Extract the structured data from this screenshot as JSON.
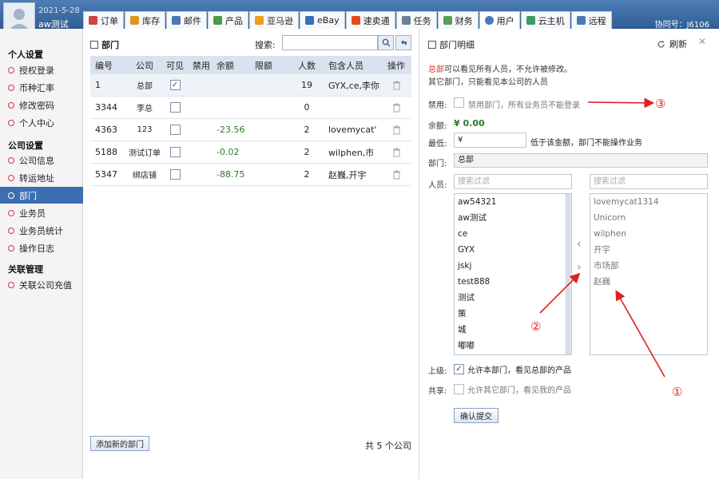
{
  "header": {
    "date": "2021-5-28",
    "user": "aw测试",
    "association_label": "协同号：",
    "association_id": "J6106",
    "tabs": [
      {
        "label": "订单",
        "icon": "order-icon",
        "color": "#c44"
      },
      {
        "label": "库存",
        "icon": "inventory-icon",
        "color": "#e39420"
      },
      {
        "label": "邮件",
        "icon": "mail-icon",
        "color": "#4a7bb7"
      },
      {
        "label": "产品",
        "icon": "product-icon",
        "color": "#4c9a4c"
      },
      {
        "label": "亚马逊",
        "icon": "amazon-icon",
        "color": "#f19e1a"
      },
      {
        "label": "eBay",
        "icon": "ebay-icon",
        "color": "#3b6fb6"
      },
      {
        "label": "速卖通",
        "icon": "aliexpress-icon",
        "color": "#e04a1f"
      },
      {
        "label": "任务",
        "icon": "task-icon",
        "color": "#6d7f96"
      },
      {
        "label": "财务",
        "icon": "finance-icon",
        "color": "#52a152"
      },
      {
        "label": "用户",
        "icon": "user-icon",
        "color": "#4a7bb7"
      },
      {
        "label": "云主机",
        "icon": "cloud-host-icon",
        "color": "#3a9a6a"
      },
      {
        "label": "远程",
        "icon": "remote-icon",
        "color": "#4a7bb7"
      }
    ]
  },
  "sidebar": {
    "groups": [
      {
        "heading": "个人设置",
        "items": [
          "授权登录",
          "币种汇率",
          "修改密码",
          "个人中心"
        ]
      },
      {
        "heading": "公司设置",
        "items": [
          "公司信息",
          "转运地址",
          "部门",
          "业务员",
          "业务员统计",
          "操作日志"
        ]
      },
      {
        "heading": "关联管理",
        "items": [
          "关联公司充值"
        ]
      }
    ],
    "active": "部门"
  },
  "left": {
    "title": "部门",
    "search_label": "搜索:",
    "columns": [
      "编号",
      "公司",
      "可见",
      "禁用",
      "余额",
      "限额",
      "人数",
      "包含人员",
      "操作"
    ],
    "rows": [
      {
        "id": "1",
        "company": "总部",
        "visible": true,
        "disabled": false,
        "balance": "",
        "limit": "",
        "count": "19",
        "members": "GYX,ce,李你"
      },
      {
        "id": "3344",
        "company": "李总",
        "visible": false,
        "disabled": false,
        "balance": "",
        "limit": "",
        "count": "0",
        "members": ""
      },
      {
        "id": "4363",
        "company": "123",
        "visible": false,
        "disabled": false,
        "balance": "-23.56",
        "limit": "",
        "count": "2",
        "members": "lovemycat'"
      },
      {
        "id": "5188",
        "company": "测试订单",
        "visible": false,
        "disabled": false,
        "balance": "-0.02",
        "limit": "",
        "count": "2",
        "members": "wilphen,市"
      },
      {
        "id": "5347",
        "company": "绑店铺",
        "visible": false,
        "disabled": false,
        "balance": "-88.75",
        "limit": "",
        "count": "2",
        "members": "赵巍,开宇"
      }
    ],
    "add_button": "添加新的部门",
    "count_text": "共 5 个公司"
  },
  "right": {
    "title": "部门明细",
    "refresh_label": "刷新",
    "info_line1_red": "总部",
    "info_line1_rest": "可以看见所有人员，不允许被修改。",
    "info_line2": "其它部门，只能看见本公司的人员",
    "disable_label": "禁用:",
    "disable_text": "禁用部门，所有业务员不能登录",
    "balance_label": "余额:",
    "balance_value": "¥ 0.00",
    "min_label": "最低:",
    "min_value": "¥",
    "min_note": "低于该金额，部门不能操作业务",
    "dept_label": "部门:",
    "dept_value": "总部",
    "people_label": "人员:",
    "filter_placeholder": "搜索过滤",
    "left_list": [
      "aw54321",
      "aw测试",
      "ce",
      "GYX",
      "jskj",
      "test888",
      "测试",
      "策",
      "城",
      "嘟嘟"
    ],
    "right_list": [
      "lovemycat1314",
      "Unicorn",
      "wilphen",
      "开宇",
      "市场部",
      "赵巍"
    ],
    "superior_label": "上级:",
    "superior_text": "允许本部门，看见总部的产品",
    "share_label": "共享:",
    "share_text": "允许其它部门，看见我的产品",
    "submit_label": "确认提交"
  },
  "annotations": [
    "①",
    "②",
    "③"
  ]
}
